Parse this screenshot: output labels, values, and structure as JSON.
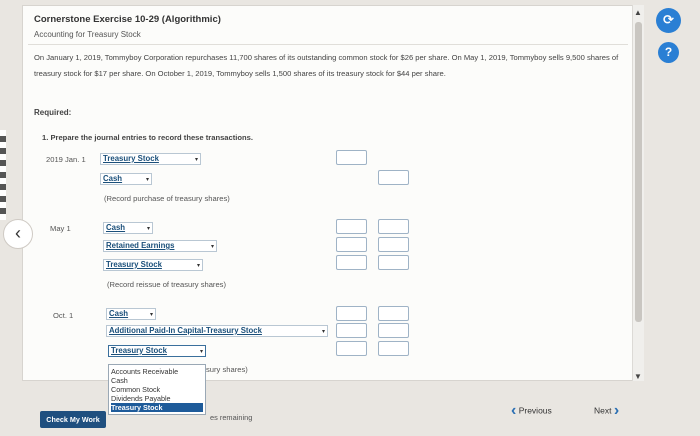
{
  "header": {
    "title": "Cornerstone Exercise 10-29 (Algorithmic)",
    "subtitle": "Accounting for Treasury Stock"
  },
  "problem": {
    "text": "On January 1, 2019, Tommyboy Corporation repurchases 11,700 shares of its outstanding common stock for $26 per share. On May 1, 2019, Tommyboy sells 9,500 shares of treasury stock for $17 per share. On October 1, 2019, Tommyboy sells 1,500 shares of its treasury stock for $44 per share."
  },
  "required": {
    "label": "Required:",
    "instruction": "1. Prepare the journal entries to record these transactions."
  },
  "entries": {
    "jan": {
      "date": "2019 Jan. 1",
      "account1": "Treasury Stock",
      "account2": "Cash",
      "note": "(Record purchase of treasury shares)"
    },
    "may": {
      "date": "May 1",
      "account1": "Cash",
      "account2": "Retained Earnings",
      "account3": "Treasury Stock",
      "note": "(Record reissue of treasury shares)"
    },
    "oct": {
      "date": "Oct. 1",
      "account1": "Cash",
      "account2": "Additional Paid-In Capital-Treasury Stock",
      "account3": "Treasury Stock",
      "note_fragment": "sury shares)"
    }
  },
  "dropdown_options": {
    "items": [
      "Accounts Receivable",
      "Cash",
      "Common Stock",
      "Dividends Payable",
      "Treasury Stock"
    ],
    "selected": "Treasury Stock"
  },
  "footer": {
    "check_label": "Check My Work",
    "remaining": "es remaining",
    "prev_label": "Previous",
    "next_label": "Next"
  },
  "icons": {
    "caret": "▾",
    "back": "‹",
    "prev": "‹",
    "next": "›",
    "refresh": "⟳",
    "help": "?",
    "scroll_up": "▲",
    "scroll_down": "▼"
  },
  "colors": {
    "link": "#1a4f7a",
    "accent": "#2a7fd4",
    "button": "#1f4f7f"
  }
}
